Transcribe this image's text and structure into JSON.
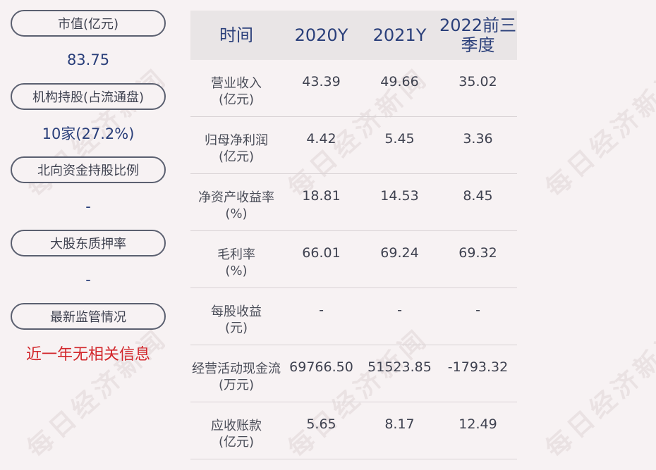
{
  "left_panel": [
    {
      "label": "市值(亿元)",
      "value": "83.75"
    },
    {
      "label": "机构持股(占流通盘)",
      "value": "10家(27.2%)"
    },
    {
      "label": "北向资金持股比例",
      "value": "-"
    },
    {
      "label": "大股东质押率",
      "value": "-"
    },
    {
      "label": "最新监管情况",
      "value": "近一年无相关信息"
    }
  ],
  "table": {
    "headers": [
      "时间",
      "2020Y",
      "2021Y",
      "2022前三季度"
    ],
    "rows": [
      {
        "label_line1": "营业收入",
        "label_line2": "(亿元)",
        "values": [
          "43.39",
          "49.66",
          "35.02"
        ]
      },
      {
        "label_line1": "归母净利润",
        "label_line2": "(亿元)",
        "values": [
          "4.42",
          "5.45",
          "3.36"
        ]
      },
      {
        "label_line1": "净资产收益率",
        "label_line2": "(%)",
        "values": [
          "18.81",
          "14.53",
          "8.45"
        ]
      },
      {
        "label_line1": "毛利率",
        "label_line2": "(%)",
        "values": [
          "66.01",
          "69.24",
          "69.32"
        ]
      },
      {
        "label_line1": "每股收益",
        "label_line2": "(元)",
        "values": [
          "-",
          "-",
          "-"
        ]
      },
      {
        "label_line1": "经营活动现金流",
        "label_line2": "(万元)",
        "values": [
          "69766.50",
          "51523.85",
          "-1793.32"
        ]
      },
      {
        "label_line1": "应收账款",
        "label_line2": "(亿元)",
        "values": [
          "5.65",
          "8.17",
          "12.49"
        ]
      }
    ]
  },
  "watermark": "每日经济新闻",
  "colors": {
    "background": "#f7f2f3",
    "header_bg": "#e9e5e6",
    "value_blue": "#2a3f7a",
    "alert_red": "#d2262b",
    "pill_border": "#5b6070"
  }
}
